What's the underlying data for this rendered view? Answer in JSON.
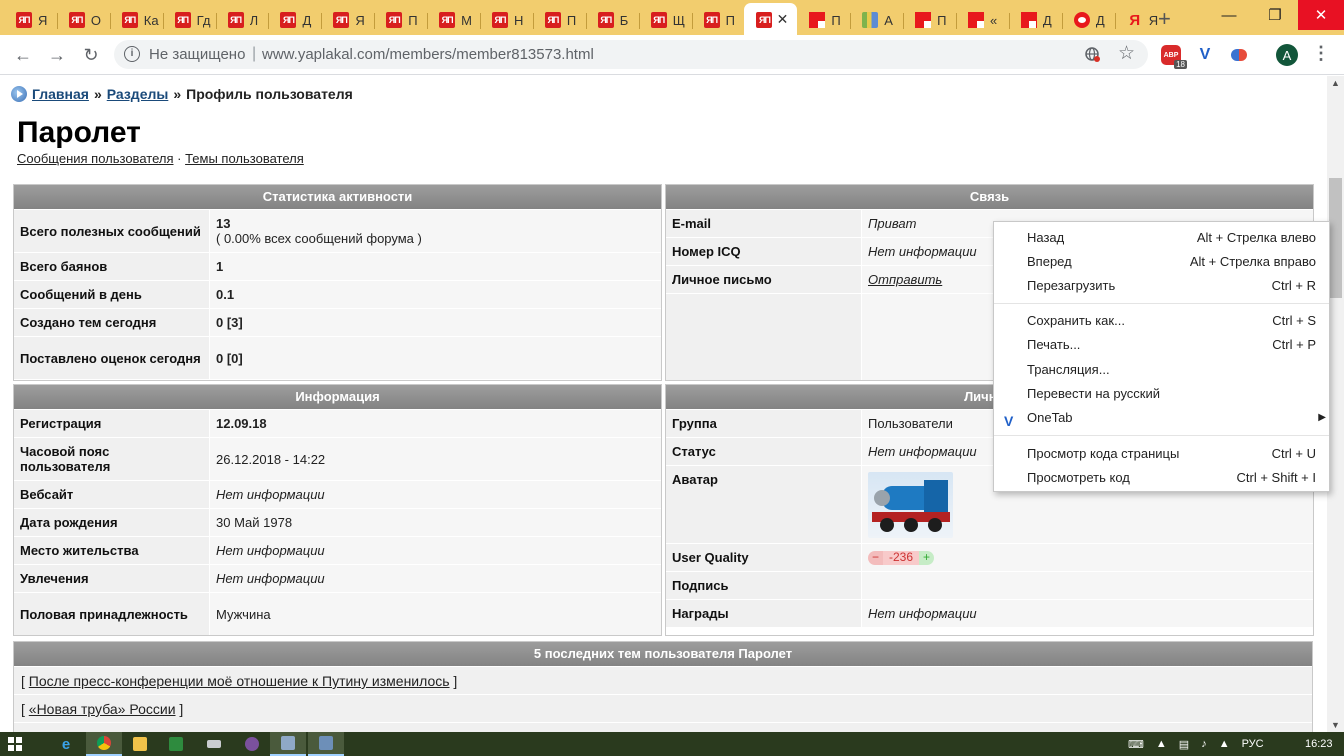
{
  "browser": {
    "tabs": [
      {
        "icon": "yap",
        "title": "Я"
      },
      {
        "icon": "yap",
        "title": "О"
      },
      {
        "icon": "yap",
        "title": "Ка"
      },
      {
        "icon": "yap",
        "title": "Гд"
      },
      {
        "icon": "yap",
        "title": "Л"
      },
      {
        "icon": "yap",
        "title": "Д"
      },
      {
        "icon": "yap",
        "title": "Я"
      },
      {
        "icon": "yap",
        "title": "П"
      },
      {
        "icon": "yap",
        "title": "М"
      },
      {
        "icon": "yap",
        "title": "Н"
      },
      {
        "icon": "yap",
        "title": "П"
      },
      {
        "icon": "yap",
        "title": "Б"
      },
      {
        "icon": "yap",
        "title": "Щ"
      },
      {
        "icon": "yap",
        "title": "П"
      },
      {
        "icon": "yap",
        "title": "",
        "active": true
      },
      {
        "icon": "red",
        "title": "П"
      },
      {
        "icon": "chart",
        "title": "А"
      },
      {
        "icon": "red",
        "title": "П"
      },
      {
        "icon": "red",
        "title": "«"
      },
      {
        "icon": "red",
        "title": "Д"
      },
      {
        "icon": "opera",
        "title": "Д"
      },
      {
        "icon": "ya",
        "title": "Я"
      }
    ],
    "security_label": "Не защищено",
    "url": "www.yaplakal.com/members/member813573.html",
    "abp_badge": "18",
    "profile_initial": "A"
  },
  "page": {
    "breadcrumb": {
      "home": "Главная",
      "sections": "Разделы",
      "current": "Профиль пользователя",
      "separator": "»"
    },
    "title": "Паролет",
    "links": {
      "messages": "Сообщения пользователя",
      "dot": "·",
      "topics": "Темы пользователя"
    },
    "stats": {
      "header": "Статистика активности",
      "rows": [
        {
          "label": "Всего полезных сообщений",
          "value": "13",
          "sub": "( 0.00% всех сообщений форума )"
        },
        {
          "label": "Всего баянов",
          "value": "1"
        },
        {
          "label": "Сообщений в день",
          "value": "0.1"
        },
        {
          "label": "Создано тем сегодня",
          "value": "0 [3]"
        },
        {
          "label": "Поставлено оценок сегодня",
          "value": "0 [0]"
        }
      ]
    },
    "contact": {
      "header": "Связь",
      "rows": [
        {
          "label": "E-mail",
          "value": "Приват"
        },
        {
          "label": "Номер ICQ",
          "value": "Нет информации"
        },
        {
          "label": "Личное письмо",
          "value": "Отправить"
        }
      ]
    },
    "info": {
      "header": "Информация",
      "rows": [
        {
          "label": "Регистрация",
          "value": "12.09.18"
        },
        {
          "label": "Часовой пояс пользователя",
          "value": "26.12.2018 - 14:22"
        },
        {
          "label": "Вебсайт",
          "value": "Нет информации"
        },
        {
          "label": "Дата рождения",
          "value": "30 Май 1978"
        },
        {
          "label": "Место жительства",
          "value": "Нет информации"
        },
        {
          "label": "Увлечения",
          "value": "Нет информации"
        },
        {
          "label": "Половая принадлежность",
          "value": "Мужчина"
        }
      ]
    },
    "personal": {
      "header": "Личные",
      "rows": [
        {
          "label": "Группа",
          "value": "Пользователи"
        },
        {
          "label": "Статус",
          "value": "Нет информации"
        },
        {
          "label": "Аватар",
          "value": ""
        },
        {
          "label": "User Quality",
          "value": "-236"
        },
        {
          "label": "Подпись",
          "value": ""
        },
        {
          "label": "Награды",
          "value": "Нет информации"
        }
      ],
      "quality_minus": "−",
      "quality_plus": "+"
    },
    "topics": {
      "header": "5 последних тем пользователя Паролет",
      "items": [
        "После пресс-конференции моё отношение к Путину изменилось",
        "«Новая труба» России"
      ]
    }
  },
  "context_menu": {
    "items": [
      {
        "label": "Назад",
        "shortcut": "Alt + Стрелка влево"
      },
      {
        "label": "Вперед",
        "shortcut": "Alt + Стрелка вправо"
      },
      {
        "label": "Перезагрузить",
        "shortcut": "Ctrl + R"
      },
      {
        "label": "Сохранить как...",
        "shortcut": "Ctrl + S"
      },
      {
        "label": "Печать...",
        "shortcut": "Ctrl + P"
      },
      {
        "label": "Трансляция...",
        "shortcut": ""
      },
      {
        "label": "Перевести на русский",
        "shortcut": ""
      },
      {
        "label": "OneTab",
        "shortcut": ""
      },
      {
        "label": "Просмотр кода страницы",
        "shortcut": "Ctrl + U"
      },
      {
        "label": "Просмотреть код",
        "shortcut": "Ctrl + Shift + I"
      }
    ]
  },
  "taskbar": {
    "language": "РУС",
    "time": "16:23"
  },
  "colors": {
    "tabstrip": "#f2cd6e",
    "box_header": "#8f8f8f",
    "taskbar": "#2a3a1e"
  }
}
